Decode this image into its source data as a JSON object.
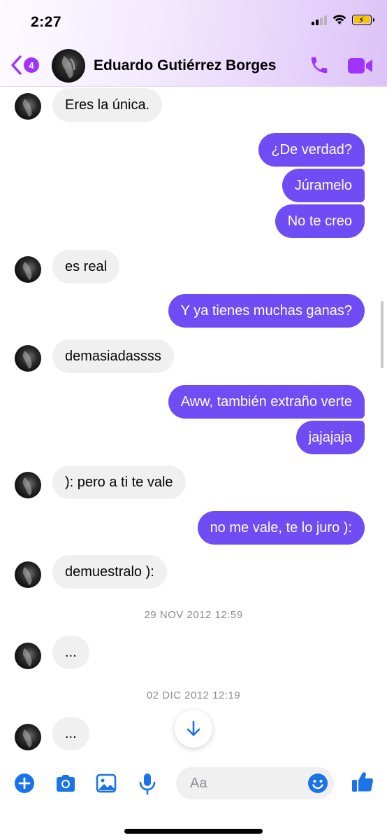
{
  "status_bar": {
    "time": "2:27"
  },
  "header": {
    "back_count": "4",
    "contact_name": "Eduardo Gutiérrez Borges"
  },
  "messages": [
    {
      "side": "in",
      "text": "Eres la única."
    },
    {
      "side": "out",
      "text": "¿De verdad?"
    },
    {
      "side": "out",
      "text": "Júramelo"
    },
    {
      "side": "out",
      "text": "No te creo"
    },
    {
      "side": "in",
      "text": "es real"
    },
    {
      "side": "out",
      "text": "Y ya tienes muchas ganas?"
    },
    {
      "side": "in",
      "text": "demasiadassss"
    },
    {
      "side": "out",
      "text": "Aww, también extraño verte"
    },
    {
      "side": "out",
      "text": "jajajaja"
    },
    {
      "side": "in",
      "text": "): pero a ti te vale"
    },
    {
      "side": "out",
      "text": "no me vale, te lo juro ):"
    },
    {
      "side": "in",
      "text": "demuestralo ):"
    },
    {
      "side": "in",
      "text": "..."
    },
    {
      "side": "in",
      "text": "..."
    }
  ],
  "timestamps": [
    "29 NOV 2012 12:59",
    "02 DIC 2012 12:19"
  ],
  "composer": {
    "placeholder": "Aa"
  },
  "colors": {
    "accent": "#a033ff",
    "outgoing_bubble": "#6f4cf4",
    "incoming_bubble": "#f0f0f0",
    "composer_icons": "#1a73e8"
  },
  "icons": [
    "back-chevron-icon",
    "phone-icon",
    "video-camera-icon",
    "plus-circle-icon",
    "camera-icon",
    "image-icon",
    "microphone-icon",
    "emoji-icon",
    "thumbs-up-icon",
    "arrow-down-icon"
  ]
}
